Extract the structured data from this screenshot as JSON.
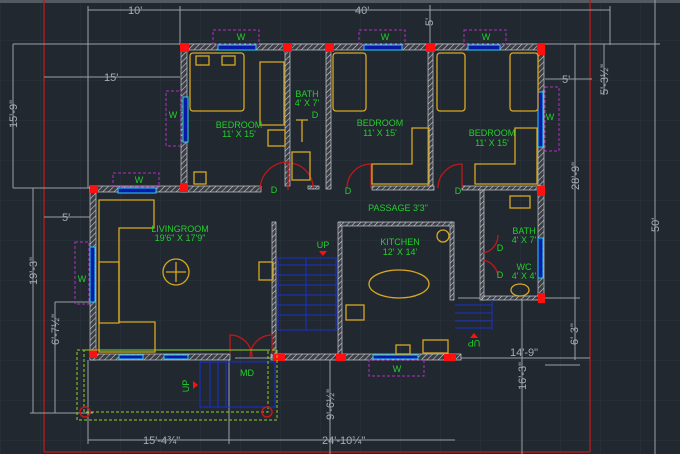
{
  "dimensions": {
    "top_left": "10'",
    "top_total": "40'",
    "left_15": "15'",
    "left_h": "15'-9\"",
    "left_5": "5'",
    "top_mid_5": "5'",
    "right_5": "5'",
    "right_53": "5'-3½\"",
    "right_289": "28'-9\"",
    "right_50": "50'",
    "left_193": "19'-3\"",
    "left_67": "6'-7½\"",
    "mid_149": "14'-9\"",
    "right_63": "6'-3\"",
    "right_163": "16'-3\"",
    "mid_96": "9'-6½\"",
    "bottom_154": "15'-4¾\"",
    "bottom_2410": "24'-10¼\""
  },
  "rooms": {
    "bedroom1": {
      "name": "BEDROOM",
      "size": "11' X 15'"
    },
    "bedroom2": {
      "name": "BEDROOM",
      "size": "11' X 15'"
    },
    "bedroom3": {
      "name": "BEDROOM",
      "size": "11' X 15'"
    },
    "bath1": {
      "name": "BATH",
      "size": "4' X 7'"
    },
    "bath2": {
      "name": "BATH",
      "size": "4' X 7'"
    },
    "wc": {
      "name": "WC",
      "size": "4' X 4'"
    },
    "living": {
      "name": "LIVINGROOM",
      "size": "19'6\" X 17'9\""
    },
    "kitchen": {
      "name": "KITCHEN",
      "size": "12' X 14'"
    },
    "passage": "PASSAGE 3'3\""
  },
  "marks": {
    "window": "W",
    "door": "D",
    "up": "UP",
    "main_door": "MD"
  },
  "colors": {
    "background": "#212830",
    "wall": "#c8cbd0",
    "column": "#ff1010",
    "label": "#22d02a",
    "furniture": "#d8a820",
    "door": "#c01818",
    "window": "#0a1aa8",
    "stair": "#1830d0",
    "boundary": "#c01818"
  }
}
